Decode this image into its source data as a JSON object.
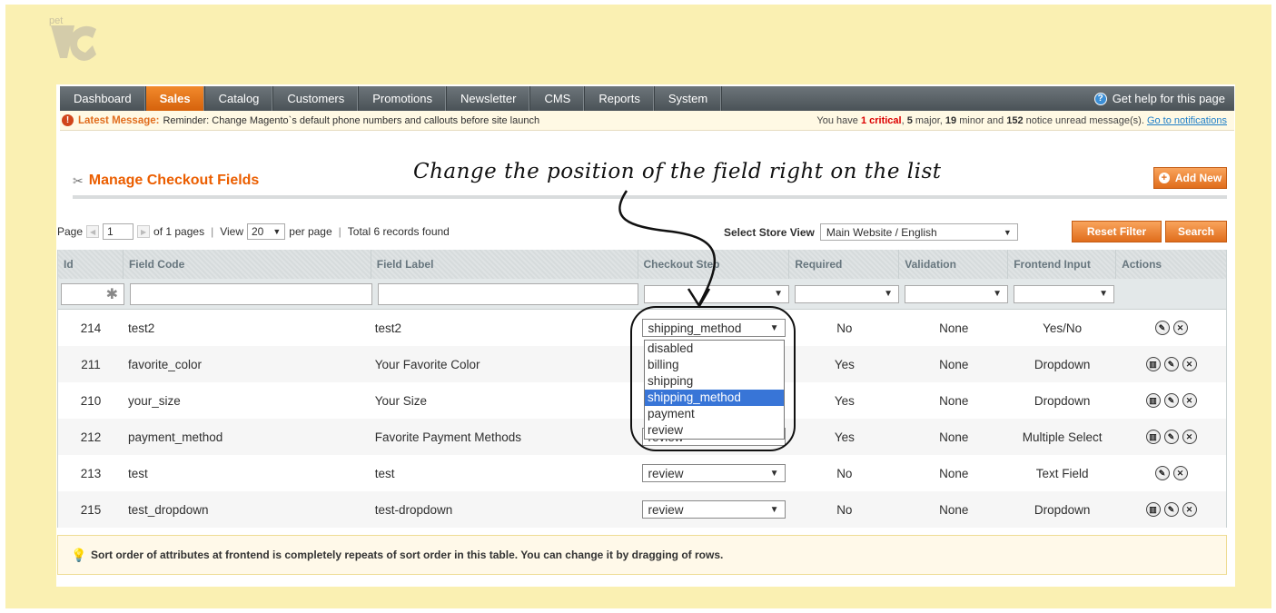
{
  "logo": {
    "text": "pet"
  },
  "nav": {
    "items": [
      "Dashboard",
      "Sales",
      "Catalog",
      "Customers",
      "Promotions",
      "Newsletter",
      "CMS",
      "Reports",
      "System"
    ],
    "active": "Sales",
    "help": "Get help for this page"
  },
  "message": {
    "label": "Latest Message:",
    "text": "Reminder: Change Magento`s default phone numbers and callouts before site launch",
    "right_prefix": "You have",
    "critical": "1 critical",
    "major": "5",
    "minor": "19",
    "notice": "152",
    "major_label": "major,",
    "minor_label": "minor and",
    "notice_label": "notice unread message(s).",
    "link": "Go to notifications"
  },
  "header": {
    "title": "Manage Checkout Fields",
    "add_new": "Add New",
    "annotation": "Change the position of the field right on the list"
  },
  "pager": {
    "page_label": "Page",
    "page_value": "1",
    "of_pages": "of 1 pages",
    "view_label": "View",
    "view_value": "20",
    "per_page": "per page",
    "records": "Total 6 records found",
    "store_label": "Select Store View",
    "store_value": "Main Website / English",
    "reset": "Reset Filter",
    "search": "Search"
  },
  "grid": {
    "columns": [
      "Id",
      "Field Code",
      "Field Label",
      "Checkout Step",
      "Required",
      "Validation",
      "Frontend Input",
      "Actions"
    ],
    "rows": [
      {
        "id": "214",
        "code": "test2",
        "label": "test2",
        "step": "shipping_method",
        "required": "No",
        "validation": "None",
        "input": "Yes/No"
      },
      {
        "id": "211",
        "code": "favorite_color",
        "label": "Your Favorite Color",
        "step": "",
        "required": "Yes",
        "validation": "None",
        "input": "Dropdown"
      },
      {
        "id": "210",
        "code": "your_size",
        "label": "Your Size",
        "step": "",
        "required": "Yes",
        "validation": "None",
        "input": "Dropdown"
      },
      {
        "id": "212",
        "code": "payment_method",
        "label": "Favorite Payment Methods",
        "step": "review",
        "required": "Yes",
        "validation": "None",
        "input": "Multiple Select"
      },
      {
        "id": "213",
        "code": "test",
        "label": "test",
        "step": "review",
        "required": "No",
        "validation": "None",
        "input": "Text Field"
      },
      {
        "id": "215",
        "code": "test_dropdown",
        "label": "test-dropdown",
        "step": "review",
        "required": "No",
        "validation": "None",
        "input": "Dropdown"
      }
    ],
    "dropdown_options": [
      "disabled",
      "billing",
      "shipping",
      "shipping_method",
      "payment",
      "review"
    ],
    "dropdown_selected": "shipping_method"
  },
  "notice": {
    "text": "Sort order of attributes at frontend is completely repeats of sort order in this table. You can change it by dragging of rows."
  },
  "colors": {
    "accent": "#eb5e00",
    "nav": "#4a5257",
    "background": "#faf0b2"
  }
}
